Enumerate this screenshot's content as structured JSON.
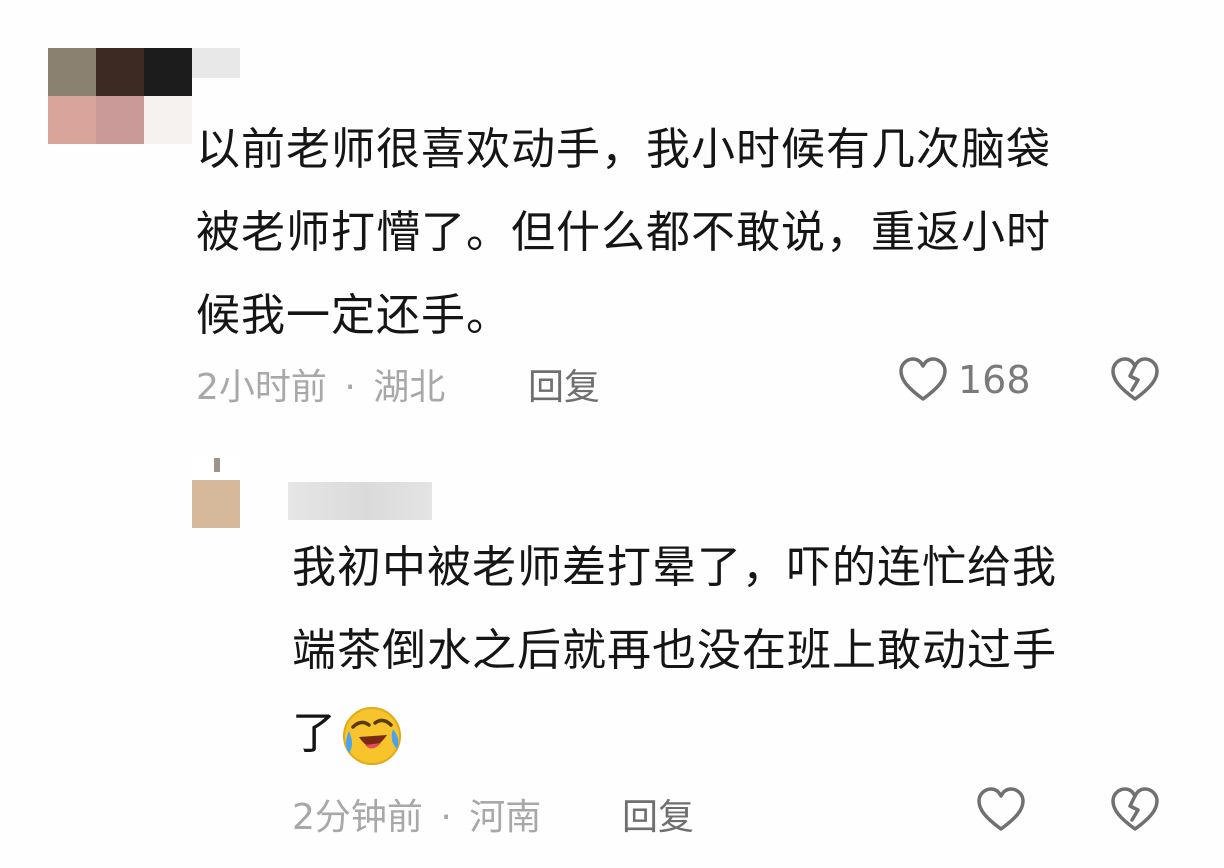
{
  "comments": [
    {
      "text_lines": [
        "以前老师很喜欢动手，我小时候有几次脑袋",
        "被老师打懵了。但什么都不敢说，重返小时",
        "候我一定还手。"
      ],
      "time": "2小时前",
      "location": "湖北",
      "separator": "·",
      "reply_label": "回复",
      "like_count": "168"
    },
    {
      "text_lines": [
        "我初中被老师差打晕了，吓的连忙给我",
        "端茶倒水之后就再也没在班上敢动过手",
        "了"
      ],
      "emoji": "laughing-crying-emoji",
      "time": "2分钟前",
      "location": "河南",
      "separator": "·",
      "reply_label": "回复",
      "like_count": ""
    }
  ],
  "icons": {
    "like": "heart-outline-icon",
    "dislike": "broken-heart-icon"
  },
  "colors": {
    "text": "#151515",
    "meta": "#a8a8a8",
    "reply": "#6f6f6f",
    "icon": "#707070"
  }
}
